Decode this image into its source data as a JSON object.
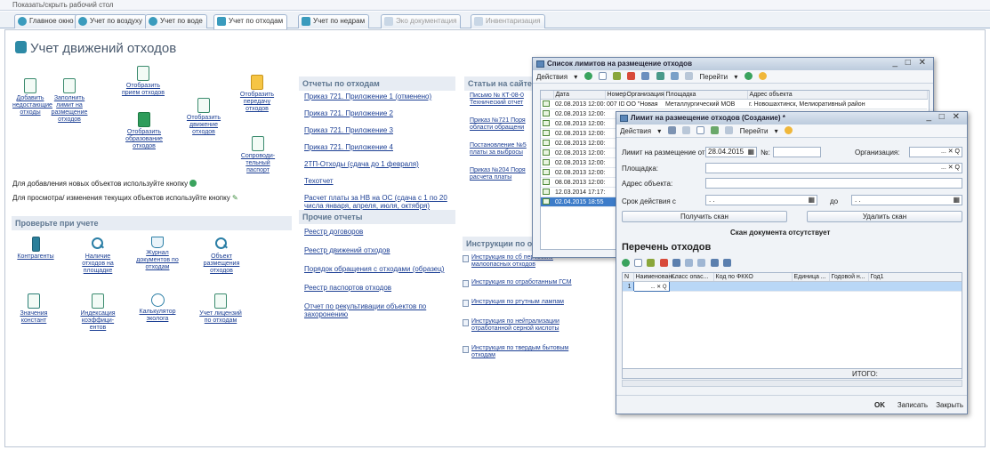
{
  "topbar": {
    "toggle_label": "Показать/скрыть рабочий стол"
  },
  "tabs": [
    {
      "label": "Главное окно",
      "active": false,
      "disabled": false
    },
    {
      "label": "Учет по воздуху",
      "active": false,
      "disabled": false
    },
    {
      "label": "Учет по воде",
      "active": false,
      "disabled": false
    },
    {
      "label": "Учет по отходам",
      "active": true,
      "disabled": false
    },
    {
      "label": "Учет по недрам",
      "active": false,
      "disabled": false
    },
    {
      "label": "Эко документация",
      "active": false,
      "disabled": true
    },
    {
      "label": "Инвентаризация",
      "active": false,
      "disabled": true
    }
  ],
  "page": {
    "title": "Учет движений отходов"
  },
  "actions": {
    "add_limit_objects": "Добавить недостающие отходы",
    "fill_limit": "Заполнить лимит на размещение отходов",
    "show_reception": "Отобразить прием отходов",
    "show_movement": "Отобразить движение отходов",
    "show_formation": "Отобразить образование отходов",
    "show_transfer": "Отобразить передачу отходов",
    "passport": "Сопроводи-тельный паспорт",
    "hint_add": "Для добавления новых объектов используйте кнопку",
    "hint_edit": "Для просмотра/ изменения текущих объектов используйте кнопку"
  },
  "check": {
    "header": "Проверьте при учете",
    "items": [
      {
        "label": "Контрагенты",
        "icon": "phone-icon"
      },
      {
        "label": "Наличие отходов на площадке",
        "icon": "magnifier-icon"
      },
      {
        "label": "Журнал документов по отходам",
        "icon": "folder-icon"
      },
      {
        "label": "Объект размещения отходов",
        "icon": "magnifier-icon"
      },
      {
        "label": "Значения констант",
        "icon": "document-icon"
      },
      {
        "label": "Индексация коэффици-ентов",
        "icon": "document-icon"
      },
      {
        "label": "Калькулятор эколога",
        "icon": "calculator-icon"
      },
      {
        "label": "Учет лицензий по отходам",
        "icon": "document-icon"
      }
    ]
  },
  "reports": {
    "header": "Отчеты по отходам",
    "items": [
      "Приказ 721. Приложение 1 (отменено)",
      "Приказ 721. Приложение 2",
      "Приказ 721. Приложение 3",
      "Приказ 721. Приложение 4",
      "2ТП-Отходы (сдача до 1 февраля)",
      "Техотчет",
      "Расчет платы за НВ на ОС (сдача с 1 по 20 числа января, апреля, июля, октября)"
    ]
  },
  "other_reports": {
    "header": "Прочие отчеты",
    "items": [
      "Реестр договоров",
      "Реестр движений отходов",
      "Порядок обращения с отходами (образец)",
      "Реестр паспортов отходов",
      "Отчет по рекультивации объектов по захоронению"
    ]
  },
  "articles": {
    "header": "Статьи на сайте",
    "items": [
      "Письмо № КТ-08-0 Технический отчет",
      "Приказ №721 Поря области обращени",
      "Постановление №5 платы за выбросы",
      "Приказ №204 Поря расчета платы"
    ]
  },
  "instructions": {
    "header": "Инструкции по от",
    "items": [
      "Инструкция по сб перевозке малоопасных отходов",
      "Инструкция по отработанным ГСМ",
      "Инструкция по ртутным лампам",
      "Инструкция по нейтрализации отработанной серной кислоты",
      "Инструкция по твердым бытовым отходам"
    ]
  },
  "limits_window": {
    "title": "Список лимитов на размещение отходов",
    "toolbar": {
      "actions": "Действия",
      "goto": "Перейти"
    },
    "columns": [
      "Дата",
      "Номер",
      "Организация",
      "Площадка",
      "Адрес объекта"
    ],
    "rows": [
      {
        "date": "02.08.2013 12:00:",
        "num": "007 ID",
        "org": "ОО \"Новая",
        "site": "Металлургический МОВ",
        "addr": "г. Новошахтинск, Мелиоративный район"
      },
      {
        "date": "02.08.2013 12:00:",
        "num": "",
        "org": "",
        "site": "",
        "addr": ""
      },
      {
        "date": "02.08.2013 12:00:",
        "num": "",
        "org": "",
        "site": "",
        "addr": ""
      },
      {
        "date": "02.08.2013 12:00:",
        "num": "",
        "org": "",
        "site": "",
        "addr": ""
      },
      {
        "date": "02.08.2013 12:00:",
        "num": "",
        "org": "",
        "site": "",
        "addr": ""
      },
      {
        "date": "02.08.2013 12:00:",
        "num": "",
        "org": "",
        "site": "",
        "addr": ""
      },
      {
        "date": "02.08.2013 12:00:",
        "num": "",
        "org": "",
        "site": "",
        "addr": ""
      },
      {
        "date": "02.08.2013 12:00:",
        "num": "",
        "org": "",
        "site": "",
        "addr": ""
      },
      {
        "date": "08.08.2013 12:00:",
        "num": "",
        "org": "",
        "site": "",
        "addr": ""
      },
      {
        "date": "12.03.2014 17:17:",
        "num": "",
        "org": "",
        "site": "",
        "addr": ""
      },
      {
        "date": "02.04.2015 18:55",
        "num": "",
        "org": "",
        "site": "",
        "addr": ""
      }
    ],
    "selected_index": 10
  },
  "limit_window": {
    "title": "Лимит на размещение отходов (Создание) *",
    "toolbar": {
      "actions": "Действия",
      "goto": "Перейти"
    },
    "form": {
      "limit_label": "Лимит на размещение от",
      "limit_date": "28.04.2015",
      "num_label": "№:",
      "num_value": "",
      "org_label": "Организация:",
      "site_label": "Площадка:",
      "addr_label": "Адрес объекта:",
      "term_label": "Срок действия с",
      "term_from": ". .",
      "term_to_label": "до",
      "term_to": ". .",
      "get_scan": "Получить скан",
      "delete_scan": "Удалить скан",
      "scan_status": "Скан документа отсутствует"
    },
    "list_title": "Перечень отходов",
    "columns": [
      "N",
      "Наименован...",
      "Класс опас...",
      "Код по ФККО",
      "Единица ...",
      "Годовой н...",
      "Год1"
    ],
    "row": {
      "n": "1"
    },
    "total_label": "ИТОГО:",
    "footer": {
      "ok": "OK",
      "save": "Записать",
      "close": "Закрыть"
    }
  }
}
